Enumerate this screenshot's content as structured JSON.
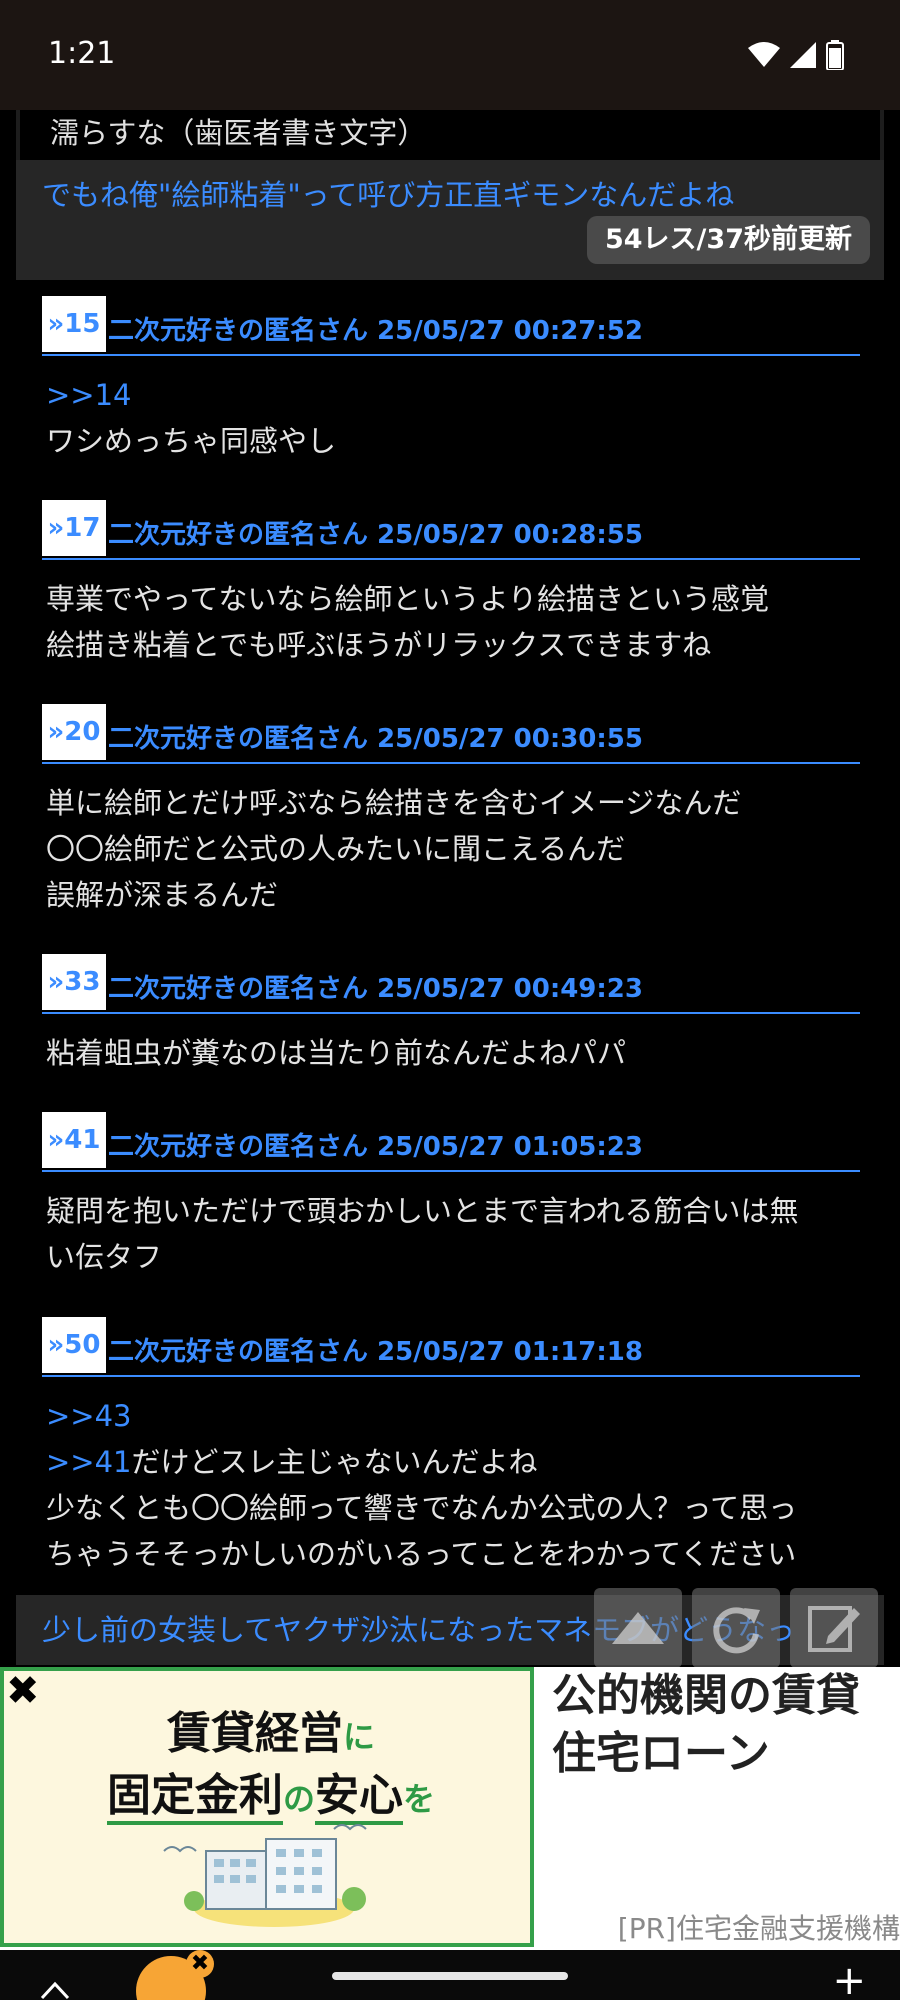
{
  "status_bar": {
    "time": "1:21"
  },
  "prev_post_tail": "濡らすな（歯医者書き文字）",
  "thread": {
    "title": "でもね俺\"絵師粘着\"って呼び方正直ギモンなんだよね",
    "meta": "54レス/37秒前更新"
  },
  "posts": [
    {
      "num": "15",
      "name": "二次元好きの匿名さん 25/05/27 00:27:52",
      "anchor1": ">>14",
      "text1": "ワシめっちゃ同感やし"
    },
    {
      "num": "17",
      "name": "二次元好きの匿名さん 25/05/27 00:28:55",
      "text1": "専業でやってないなら絵師というより絵描きという感覚",
      "text2": "絵描き粘着とでも呼ぶほうがリラックスできますね"
    },
    {
      "num": "20",
      "name": "二次元好きの匿名さん 25/05/27 00:30:55",
      "text1": "単に絵師とだけ呼ぶなら絵描きを含むイメージなんだ",
      "text2": "〇〇絵師だと公式の人みたいに聞こえるんだ",
      "text3": "誤解が深まるんだ"
    },
    {
      "num": "33",
      "name": "二次元好きの匿名さん 25/05/27 00:49:23",
      "text1": "粘着蛆虫が糞なのは当たり前なんだよねパパ"
    },
    {
      "num": "41",
      "name": "二次元好きの匿名さん 25/05/27 01:05:23",
      "text1": "疑問を抱いただけで頭おかしいとまで言われる筋合いは無",
      "text2": "い伝タフ"
    },
    {
      "num": "50",
      "name": "二次元好きの匿名さん 25/05/27 01:17:18",
      "anchor1": ">>43",
      "anchor2": ">>41",
      "text2": "だけどスレ主じゃないんだよね",
      "text3": "少なくとも〇〇絵師って響きでなんか公式の人？って思っ",
      "text4": "ちゃうそそっかしいのがいるってことをわかってください"
    }
  ],
  "next_thread_title": "少し前の女装してヤクザ沙汰になったマネモブがどうなっ",
  "fab_buttons": [
    "scroll-up-icon",
    "refresh-icon",
    "compose-icon"
  ],
  "ad": {
    "banner_line1_a": "賃貸経営",
    "banner_line1_b": "に",
    "banner_line2_a": "固定金利",
    "banner_line2_b": "の",
    "banner_line2_c": "安心",
    "banner_line2_d": "を",
    "title": "公的機関の賃貸住宅ローン",
    "source": "[PR]住宅金融支援機構"
  },
  "colors": {
    "accent": "#3b8cff",
    "ad_green": "#35a04a",
    "badge_orange": "#f7a535"
  }
}
